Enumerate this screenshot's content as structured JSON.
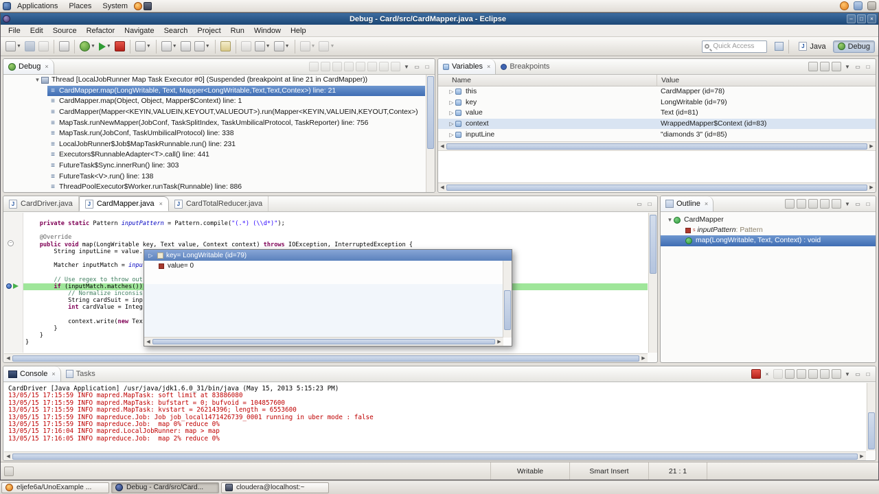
{
  "desktop": {
    "panel_menus": [
      "Applications",
      "Places",
      "System"
    ],
    "tray_icons": [
      "notification-icon",
      "input-method-icon",
      "volume-icon"
    ],
    "taskbar_windows": [
      "eljefe6a/UnoExample ...",
      "Debug - Card/src/Card...",
      "cloudera@localhost:~"
    ]
  },
  "window": {
    "title": "Debug - Card/src/CardMapper.java - Eclipse"
  },
  "menubar": [
    "File",
    "Edit",
    "Source",
    "Refactor",
    "Navigate",
    "Search",
    "Project",
    "Run",
    "Window",
    "Help"
  ],
  "toolbar": {
    "quick_access_placeholder": "Quick Access",
    "icons": [
      "new-wizard",
      "save",
      "print",
      "skip-all-breakpoints",
      "debug",
      "run",
      "terminate",
      "external-tools",
      "new-java-project",
      "new-package",
      "new-class",
      "search",
      "back",
      "forward",
      "last-edit-location",
      "next-annotation",
      "previous-annotation"
    ],
    "perspectives": [
      {
        "label": "Java"
      },
      {
        "label": "Debug"
      }
    ]
  },
  "debug": {
    "tab": "Debug",
    "header_icons": [
      "remove-terminated",
      "resume",
      "suspend",
      "terminate",
      "disconnect",
      "step-into",
      "step-over",
      "step-return",
      "view-menu",
      "minimize",
      "maximize"
    ],
    "thread": "Thread [LocalJobRunner Map Task Executor #0] (Suspended (breakpoint at line 21 in CardMapper))",
    "frames": [
      "CardMapper.map(LongWritable, Text, Mapper<LongWritable,Text,Text,Contex>) line: 21",
      "CardMapper.map(Object, Object, Mapper$Context) line: 1",
      "CardMapper(Mapper<KEYIN,VALUEIN,KEYOUT,VALUEOUT>).run(Mapper<KEYIN,VALUEIN,KEYOUT,Contex>)",
      "MapTask.runNewMapper(JobConf, TaskSplitIndex, TaskUmbilicalProtocol, TaskReporter) line: 756",
      "MapTask.run(JobConf, TaskUmbilicalProtocol) line: 338",
      "LocalJobRunner$Job$MapTaskRunnable.run() line: 231",
      "Executors$RunnableAdapter<T>.call() line: 441",
      "FutureTask$Sync.innerRun() line: 303",
      "FutureTask<V>.run() line: 138",
      "ThreadPoolExecutor$Worker.runTask(Runnable) line: 886"
    ]
  },
  "variables": {
    "tabs": [
      "Variables",
      "Breakpoints"
    ],
    "header_icons": [
      "show-type-names",
      "show-logical-structure",
      "collapse-all",
      "view-menu",
      "minimize",
      "maximize"
    ],
    "columns": [
      "Name",
      "Value"
    ],
    "rows": [
      {
        "name": "this",
        "value": "CardMapper (id=78)"
      },
      {
        "name": "key",
        "value": "LongWritable (id=79)"
      },
      {
        "name": "value",
        "value": "Text (id=81)"
      },
      {
        "name": "context",
        "value": "WrappedMapper$Context (id=83)"
      },
      {
        "name": "inputLine",
        "value": "\"diamonds 3\" (id=85)"
      }
    ]
  },
  "editor": {
    "tabs": [
      "CardDriver.java",
      "CardMapper.java",
      "CardTotalReducer.java"
    ],
    "code": [
      [
        "    private static ",
        "Pattern ",
        "inputPattern",
        " = Pattern.compile(",
        "\"(.*) (\\\\d*)\"",
        ");"
      ],
      [],
      [
        "    @Override"
      ],
      [
        "    public void ",
        "map(LongWritable key, Text value, Context context) ",
        "throws ",
        "IOException, InterruptedException {"
      ],
      [
        "        String inputLine = value."
      ],
      [],
      [
        "        Matcher inputMatch = ",
        "inpu"
      ],
      [],
      [
        "        // Use regex to throw out"
      ],
      [
        "        ",
        "if",
        " (inputMatch.matches())"
      ],
      [
        "            // Normalize inconsis"
      ],
      [
        "            String cardSuit = inp"
      ],
      [
        "            int",
        " cardValue = Integ"
      ],
      [],
      [
        "            context.write(",
        "new",
        " Tex"
      ],
      [
        "        }"
      ],
      [
        "    }"
      ],
      [
        "}"
      ]
    ],
    "popup": {
      "header": "key= LongWritable (id=79)",
      "row": "value= 0"
    }
  },
  "outline": {
    "tab": "Outline",
    "header_icons": [
      "sort",
      "hide-fields",
      "hide-static-members",
      "hide-non-public",
      "link-with-editor",
      "view-menu",
      "minimize",
      "maximize"
    ],
    "class_name": "CardMapper",
    "field_name": "inputPattern",
    "field_type": " : Pattern",
    "method": "map(LongWritable, Text, Context) : void"
  },
  "console": {
    "tabs": [
      "Console",
      "Tasks"
    ],
    "header_icons": [
      "terminate",
      "remove-launch",
      "remove-all-terminated",
      "clear-console",
      "scroll-lock",
      "pin-console",
      "display-selected-console",
      "open-console",
      "view-menu",
      "minimize",
      "maximize"
    ],
    "header": "CardDriver [Java Application] /usr/java/jdk1.6.0_31/bin/java (May 15, 2013 5:15:23 PM)",
    "lines": [
      "13/05/15 17:15:59 INFO mapred.MapTask: soft limit at 83886080",
      "13/05/15 17:15:59 INFO mapred.MapTask: bufstart = 0; bufvoid = 104857600",
      "13/05/15 17:15:59 INFO mapred.MapTask: kvstart = 26214396; length = 6553600",
      "13/05/15 17:15:59 INFO mapreduce.Job: Job job_local1471426739_0001 running in uber mode : false",
      "13/05/15 17:15:59 INFO mapreduce.Job:  map 0% reduce 0%",
      "13/05/15 17:16:04 INFO mapred.LocalJobRunner: map > map",
      "13/05/15 17:16:05 INFO mapreduce.Job:  map 2% reduce 0%"
    ]
  },
  "statusbar": {
    "writable": "Writable",
    "insert_mode": "Smart Insert",
    "caret": "21 : 1"
  },
  "colors": {
    "titlebar": "#24507e",
    "selection_blue": "#4272b4",
    "console_error": "#bf0000",
    "debug_current_line": "#9fe69a",
    "breakpoint_blue": "#2a58a8"
  }
}
